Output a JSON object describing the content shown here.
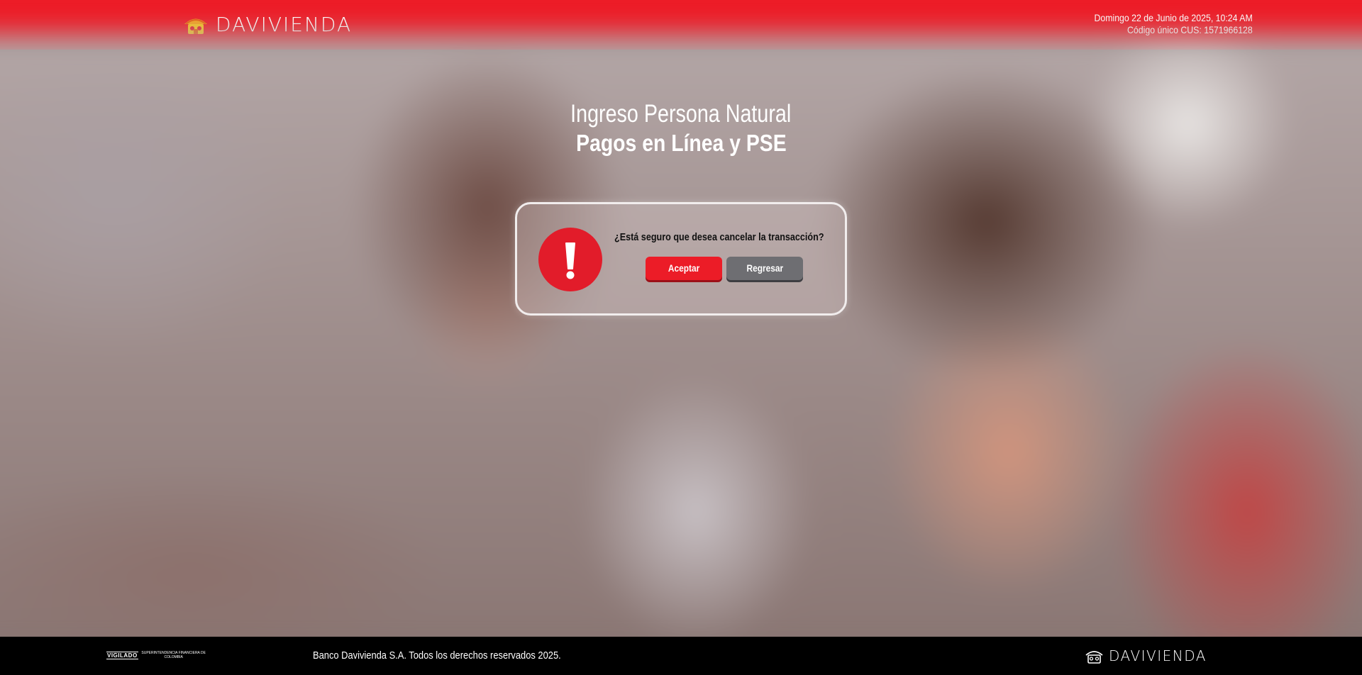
{
  "header": {
    "brand": "DAVIVIENDA",
    "date_text": "Domingo 22 de Junio de 2025, 10:24 AM",
    "cus_text": "Código único CUS: 1571966128",
    "color": "#ed1c27"
  },
  "page": {
    "title_light": "Ingreso Persona Natural",
    "title_bold": "Pagos en Línea y PSE"
  },
  "dialog": {
    "icon": "exclamation-icon",
    "message": "¿Está seguro que desea cancelar la transacción?",
    "accept_label": "Aceptar",
    "back_label": "Regresar",
    "accent": "#e21c2a"
  },
  "footer": {
    "vigilado_label": "VIGILADO",
    "vigilado_sub": "SUPERINTENDENCIA FINANCIERA DE COLOMBIA",
    "copyright": "Banco Davivienda S.A. Todos los derechos reservados 2025.",
    "brand": "DAVIVIENDA"
  }
}
